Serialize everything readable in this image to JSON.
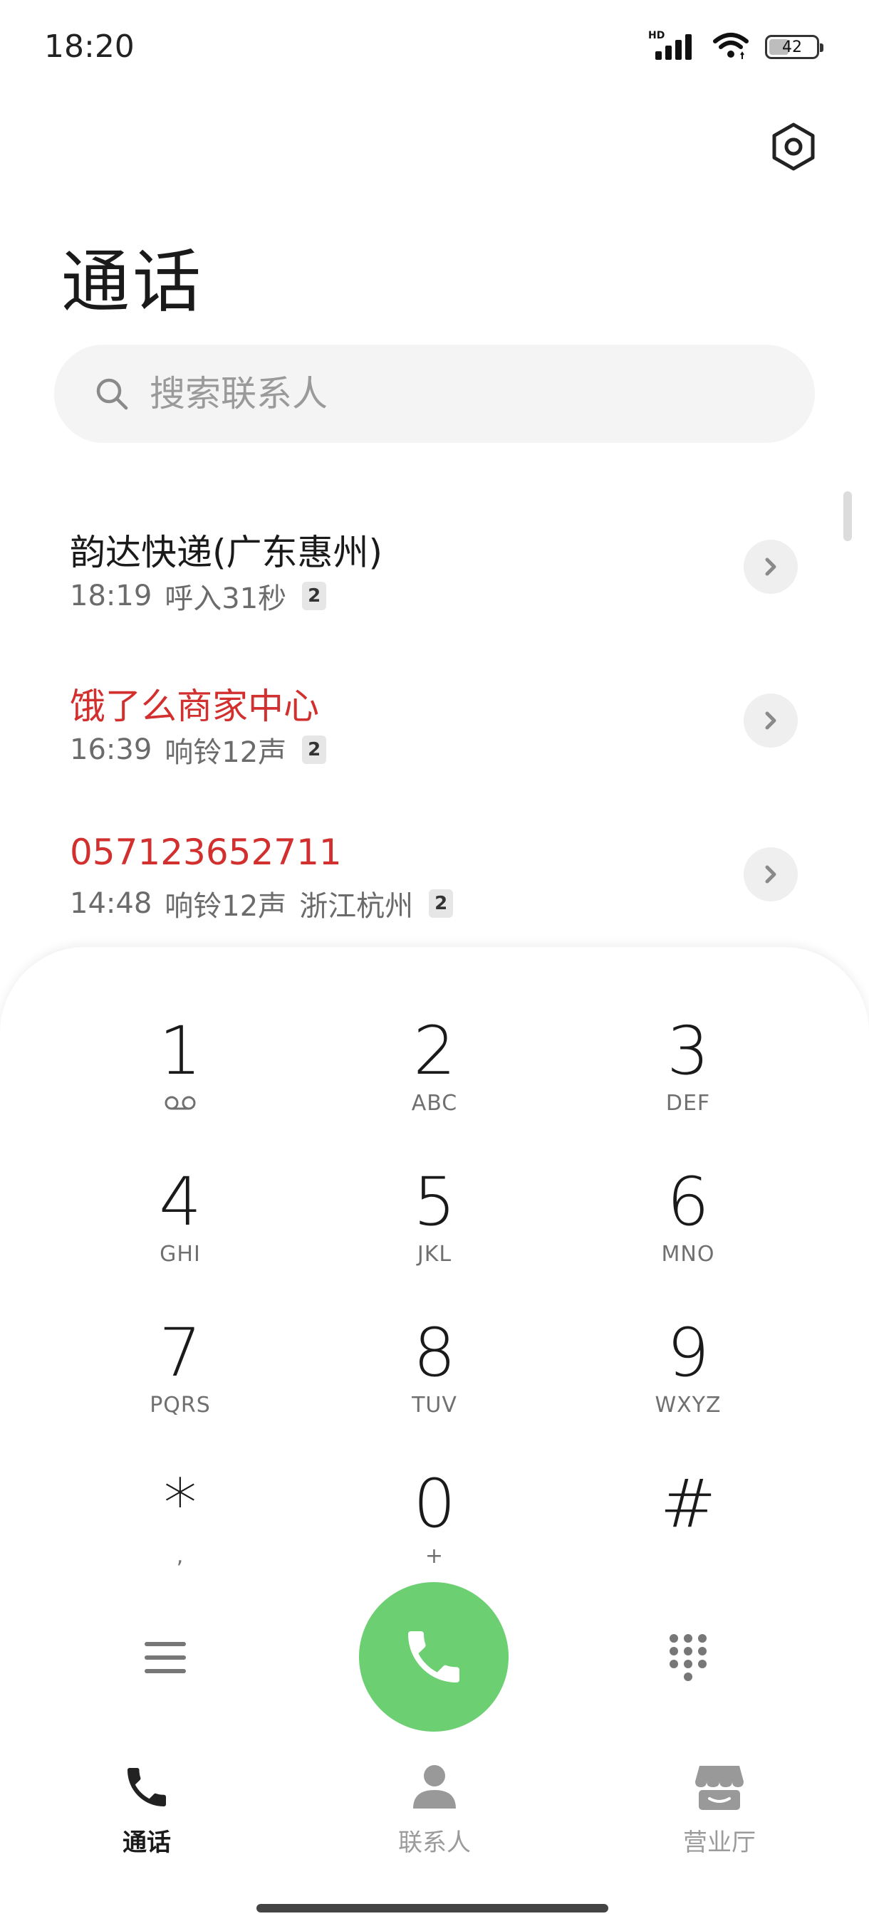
{
  "status_bar": {
    "time": "18:20",
    "network_label": "HD",
    "battery_level": "42",
    "battery_fraction": 0.42,
    "icons": [
      "hd-signal-icon",
      "wifi-icon",
      "battery-icon"
    ]
  },
  "header": {
    "title": "通话",
    "settings_icon": "gear-icon"
  },
  "search": {
    "placeholder": "搜索联系人",
    "icon": "search-icon"
  },
  "calls": [
    {
      "name": "韵达快递(广东惠州)",
      "time": "18:19",
      "detail": "呼入31秒",
      "location": "",
      "sim": "2",
      "missed": false
    },
    {
      "name": "饿了么商家中心",
      "time": "16:39",
      "detail": "响铃12声",
      "location": "",
      "sim": "2",
      "missed": true
    },
    {
      "name": "057123652711",
      "time": "14:48",
      "detail": "响铃12声",
      "location": "浙江杭州",
      "sim": "2",
      "missed": true
    }
  ],
  "dialpad": {
    "keys": [
      {
        "digit": "1",
        "letters": ""
      },
      {
        "digit": "2",
        "letters": "ABC"
      },
      {
        "digit": "3",
        "letters": "DEF"
      },
      {
        "digit": "4",
        "letters": "GHI"
      },
      {
        "digit": "5",
        "letters": "JKL"
      },
      {
        "digit": "6",
        "letters": "MNO"
      },
      {
        "digit": "7",
        "letters": "PQRS"
      },
      {
        "digit": "8",
        "letters": "TUV"
      },
      {
        "digit": "9",
        "letters": "WXYZ"
      },
      {
        "digit": "*",
        "letters": ","
      },
      {
        "digit": "0",
        "letters": "+"
      },
      {
        "digit": "#",
        "letters": ""
      }
    ],
    "call_button_color": "#6ccf72"
  },
  "nav": {
    "items": [
      {
        "label": "通话",
        "icon": "phone-icon",
        "active": true
      },
      {
        "label": "联系人",
        "icon": "person-icon",
        "active": false
      },
      {
        "label": "营业厅",
        "icon": "store-icon",
        "active": false
      }
    ]
  },
  "colors": {
    "missed": "#d22f2f",
    "accent_green": "#6ccf72",
    "text_primary": "#1a1a1a",
    "text_secondary": "#6b6b6b"
  }
}
